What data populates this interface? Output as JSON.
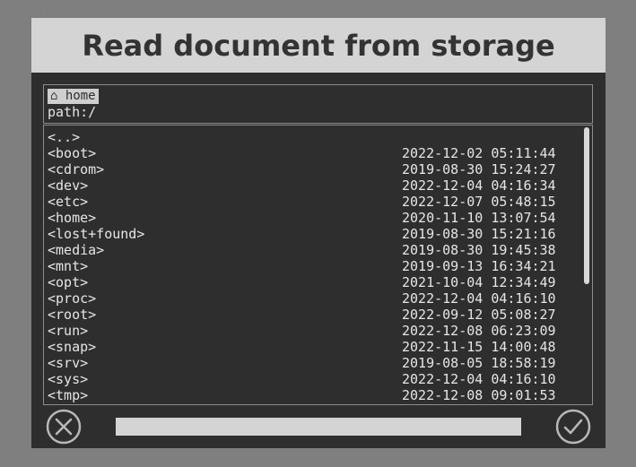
{
  "background_label": "... ....",
  "dialog": {
    "title": "Read document from storage",
    "location": {
      "home_chip": "⌂ home",
      "path": "path:/"
    },
    "entries": [
      {
        "name": "<..>",
        "date": ""
      },
      {
        "name": "<boot>",
        "date": "2022-12-02 05:11:44"
      },
      {
        "name": "<cdrom>",
        "date": "2019-08-30 15:24:27"
      },
      {
        "name": "<dev>",
        "date": "2022-12-04 04:16:34"
      },
      {
        "name": "<etc>",
        "date": "2022-12-07 05:48:15"
      },
      {
        "name": "<home>",
        "date": "2020-11-10 13:07:54"
      },
      {
        "name": "<lost+found>",
        "date": "2019-08-30 15:21:16"
      },
      {
        "name": "<media>",
        "date": "2019-08-30 19:45:38"
      },
      {
        "name": "<mnt>",
        "date": "2019-09-13 16:34:21"
      },
      {
        "name": "<opt>",
        "date": "2021-10-04 12:34:49"
      },
      {
        "name": "<proc>",
        "date": "2022-12-04 04:16:10"
      },
      {
        "name": "<root>",
        "date": "2022-09-12 05:08:27"
      },
      {
        "name": "<run>",
        "date": "2022-12-08 06:23:09"
      },
      {
        "name": "<snap>",
        "date": "2022-11-15 14:00:48"
      },
      {
        "name": "<srv>",
        "date": "2019-08-05 18:58:19"
      },
      {
        "name": "<sys>",
        "date": "2022-12-04 04:16:10"
      },
      {
        "name": "<tmp>",
        "date": "2022-12-08 09:01:53"
      }
    ],
    "filename_value": "",
    "icons": {
      "cancel": "close-circle-icon",
      "confirm": "check-circle-icon"
    },
    "colors": {
      "dialog_bg": "#2e2e2e",
      "title_bg": "#d4d4d4",
      "text": "#e6e6e6",
      "border": "#8c8c8c"
    }
  }
}
